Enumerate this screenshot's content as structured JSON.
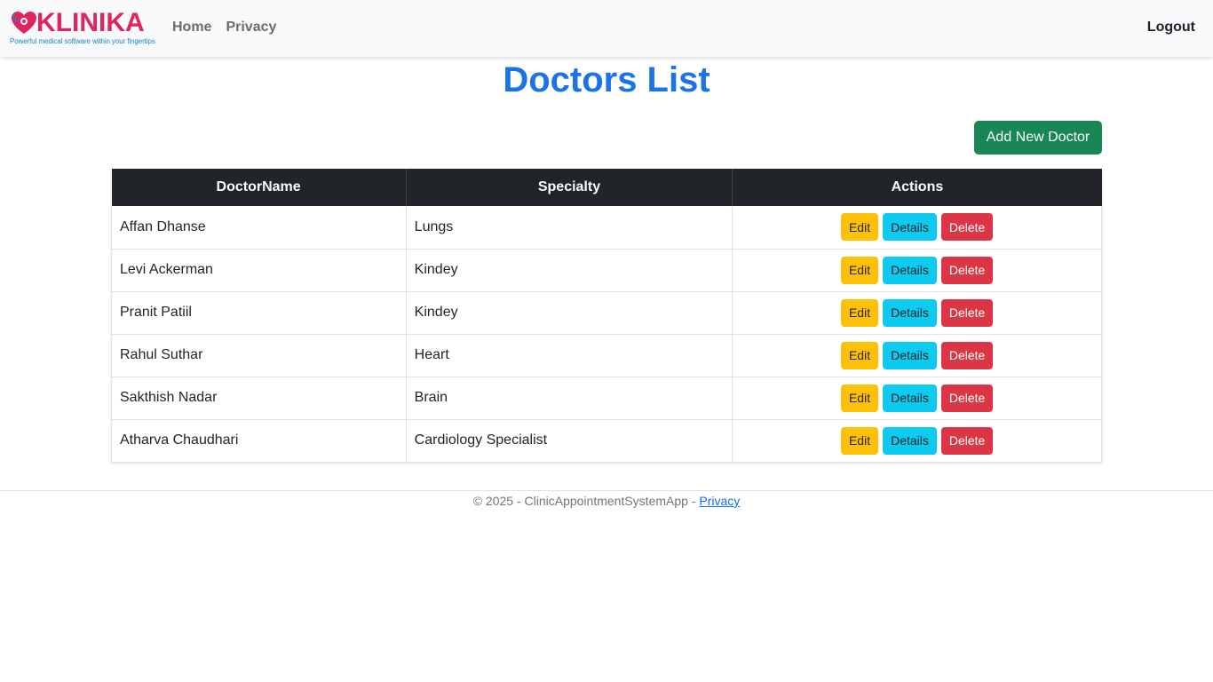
{
  "navbar": {
    "brand_name": "KLINIKA",
    "brand_tagline": "Powerful medical software within your fingertips",
    "links": [
      {
        "label": "Home"
      },
      {
        "label": "Privacy"
      }
    ],
    "logout_label": "Logout"
  },
  "page": {
    "title": "Doctors List",
    "add_button_label": "Add New Doctor"
  },
  "table": {
    "headers": [
      "DoctorName",
      "Specialty",
      "Actions"
    ],
    "rows": [
      {
        "name": "Affan Dhanse",
        "specialty": "Lungs"
      },
      {
        "name": "Levi Ackerman",
        "specialty": "Kindey"
      },
      {
        "name": "Pranit Patiil",
        "specialty": "Kindey"
      },
      {
        "name": "Rahul Suthar",
        "specialty": "Heart"
      },
      {
        "name": "Sakthish Nadar",
        "specialty": "Brain"
      },
      {
        "name": "Atharva Chaudhari",
        "specialty": "Cardiology Specialist"
      }
    ],
    "action_labels": {
      "edit": "Edit",
      "details": "Details",
      "delete": "Delete"
    }
  },
  "footer": {
    "text": "© 2025 - ClinicAppointmentSystemApp - ",
    "privacy_link": "Privacy"
  },
  "colors": {
    "brand": "#e0245e",
    "title": "#1a73e8",
    "add_button": "#198754",
    "edit": "#ffc107",
    "details": "#0dcaf0",
    "delete": "#dc3545",
    "table_header": "#212529"
  }
}
